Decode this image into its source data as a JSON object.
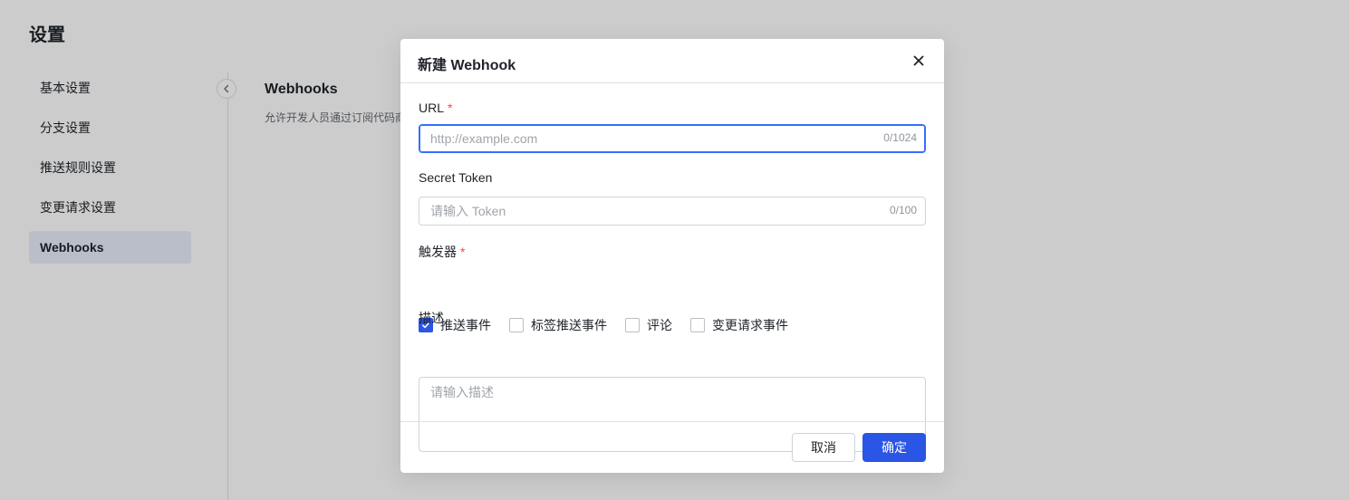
{
  "page": {
    "title": "设置",
    "nav": [
      {
        "label": "基本设置"
      },
      {
        "label": "分支设置"
      },
      {
        "label": "推送规则设置"
      },
      {
        "label": "变更请求设置"
      },
      {
        "label": "Webhooks"
      }
    ],
    "active_nav": "Webhooks",
    "content_title": "Webhooks",
    "content_desc": "允许开发人员通过订阅代码商"
  },
  "modal": {
    "title": "新建 Webhook",
    "url": {
      "label": "URL",
      "required_mark": "*",
      "placeholder": "http://example.com",
      "value": "",
      "counter": "0/1024"
    },
    "token": {
      "label": "Secret Token",
      "placeholder": "请输入 Token",
      "value": "",
      "counter": "0/100"
    },
    "triggers": {
      "label": "触发器",
      "required_mark": "*",
      "options": [
        {
          "label": "推送事件",
          "checked": true
        },
        {
          "label": "标签推送事件",
          "checked": false
        },
        {
          "label": "评论",
          "checked": false
        },
        {
          "label": "变更请求事件",
          "checked": false
        }
      ]
    },
    "description": {
      "label": "描述",
      "placeholder": "请输入描述",
      "value": ""
    },
    "cancel_label": "取消",
    "ok_label": "确定"
  },
  "colors": {
    "accent": "#2a55e5",
    "required": "#f54a45",
    "focus": "#3370ff"
  },
  "icons": {
    "close": "close-icon",
    "collapse": "chevron-left-icon",
    "check": "check-icon"
  }
}
